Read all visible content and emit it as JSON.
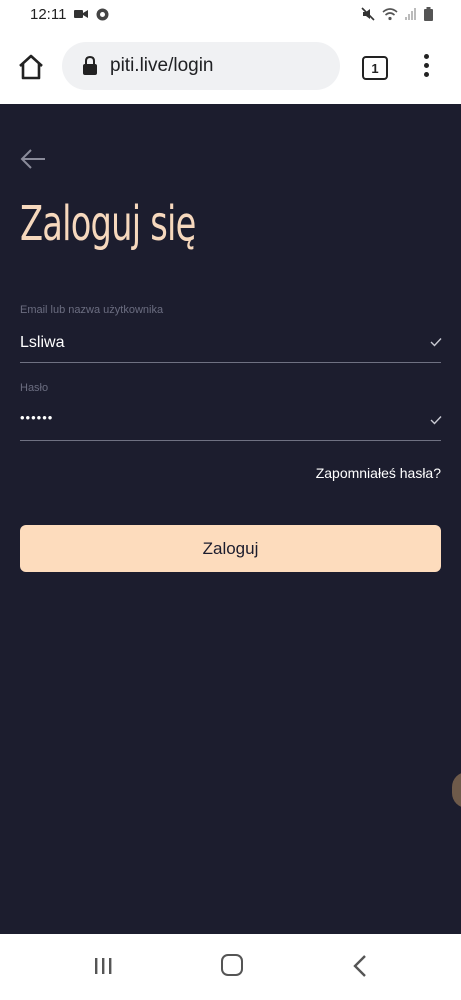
{
  "status_bar": {
    "time": "12:11",
    "left_icons": [
      "video-camera-icon",
      "chrome-icon"
    ],
    "right_icons": [
      "mute-icon",
      "wifi-icon",
      "signal-icon",
      "battery-icon"
    ]
  },
  "browser": {
    "url": "piti.live/login",
    "tab_count": "1",
    "icons": [
      "home-icon",
      "lock-icon",
      "tabs-icon",
      "more-vert-icon"
    ]
  },
  "page": {
    "background": "#1c1d2e",
    "title": "Zaloguj się",
    "title_color": "#f6d8bd",
    "back_icon": "arrow-left-icon",
    "email_field": {
      "label": "Email lub nazwa użytkownika",
      "value": "Lsliwa"
    },
    "password_field": {
      "label": "Hasło",
      "value": "••••••"
    },
    "forgot_link": "Zapomniałeś hasła?",
    "login_button": "Zaloguj",
    "button_color": "#fddcbd"
  },
  "nav_bar": {
    "icons": [
      "recents-icon",
      "home-circle-icon",
      "back-chevron-icon"
    ]
  }
}
